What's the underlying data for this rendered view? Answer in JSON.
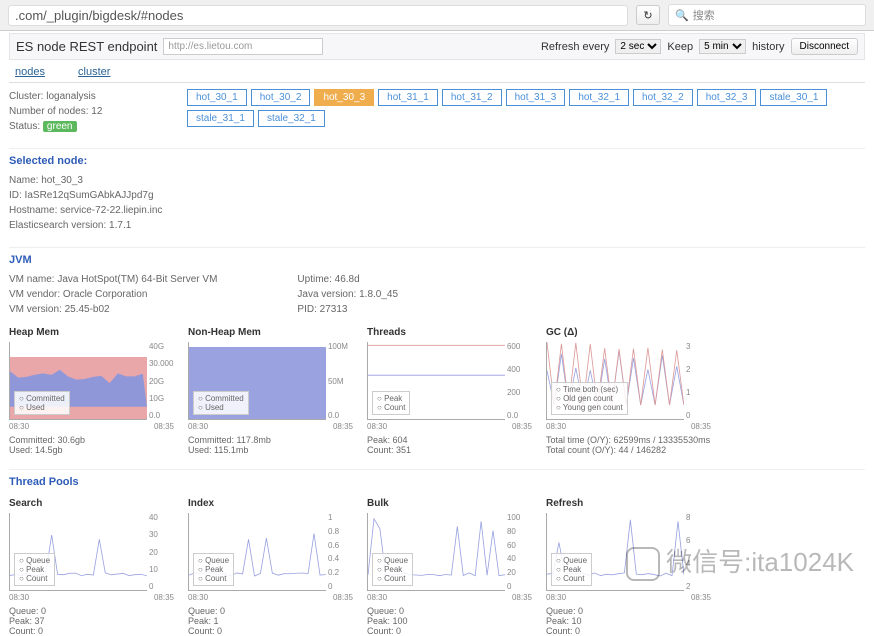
{
  "browser": {
    "url": ".com/_plugin/bigdesk/#nodes",
    "search_placeholder": "搜索"
  },
  "header": {
    "endpoint_label": "ES node REST endpoint",
    "endpoint_value": "http://es.lietou.com",
    "refresh_label": "Refresh every",
    "refresh_options": [
      "2 sec"
    ],
    "refresh_selected": "2 sec",
    "keep_label": "Keep",
    "keep_options": [
      "5 min"
    ],
    "keep_selected": "5 min",
    "history_label": "history",
    "disconnect_label": "Disconnect",
    "tabs": {
      "nodes": "nodes",
      "cluster": "cluster"
    }
  },
  "cluster": {
    "name_label": "Cluster: loganalysis",
    "nodes_label": "Number of nodes: 12",
    "status_label": "Status:",
    "status_value": "green"
  },
  "nodes": [
    "hot_30_1",
    "hot_30_2",
    "hot_30_3",
    "hot_31_1",
    "hot_31_2",
    "hot_31_3",
    "hot_32_1",
    "hot_32_2",
    "hot_32_3",
    "stale_30_1",
    "stale_31_1",
    "stale_32_1"
  ],
  "selected_node_index": 2,
  "selected_node": {
    "title": "Selected node:",
    "name": "Name: hot_30_3",
    "id": "ID: IaSRe12qSumGAbkAJJpd7g",
    "hostname": "Hostname: service-72-22.liepin.inc",
    "version": "Elasticsearch version: 1.7.1"
  },
  "jvm": {
    "title": "JVM",
    "left": {
      "vm_name": "VM name: Java HotSpot(TM) 64-Bit Server VM",
      "vm_vendor": "VM vendor: Oracle Corporation",
      "vm_version": "VM version: 25.45-b02"
    },
    "right": {
      "uptime": "Uptime: 46.8d",
      "java_version": "Java version: 1.8.0_45",
      "pid": "PID: 27313"
    }
  },
  "chart_data": [
    {
      "type": "area",
      "title": "Heap Mem",
      "x": [
        "08:30",
        "08:35"
      ],
      "y_ticks": [
        "40G",
        "30.000",
        "20G",
        "10G",
        "0.0"
      ],
      "series": [
        {
          "name": "Committed",
          "values": [
            30.6,
            30.6
          ]
        },
        {
          "name": "Used",
          "values": [
            14,
            15,
            18,
            14,
            16,
            19,
            14,
            17,
            15,
            16,
            14,
            18,
            15,
            14
          ]
        }
      ],
      "stats": {
        "committed": "Committed: 30.6gb",
        "used": "Used: 14.5gb"
      }
    },
    {
      "type": "area",
      "title": "Non-Heap Mem",
      "x": [
        "08:30",
        "08:35"
      ],
      "y_ticks": [
        "100M",
        "50M",
        "0.0"
      ],
      "series": [
        {
          "name": "Committed",
          "values": [
            117.8,
            117.8
          ]
        },
        {
          "name": "Used",
          "values": [
            115.1,
            115.1
          ]
        }
      ],
      "stats": {
        "committed": "Committed: 117.8mb",
        "used": "Used: 115.1mb"
      }
    },
    {
      "type": "line",
      "title": "Threads",
      "x": [
        "08:30",
        "08:35"
      ],
      "y_ticks": [
        "600",
        "400",
        "200",
        "0.0"
      ],
      "series": [
        {
          "name": "Peak",
          "values": [
            604,
            604
          ]
        },
        {
          "name": "Count",
          "values": [
            351,
            351
          ]
        }
      ],
      "stats": {
        "peak": "Peak: 604",
        "count": "Count: 351"
      }
    },
    {
      "type": "line",
      "title": "GC (Δ)",
      "x": [
        "08:30",
        "08:35"
      ],
      "y_ticks": [
        "3",
        "2",
        "1",
        "0"
      ],
      "series": [
        {
          "name": "Time both (sec)",
          "values": [
            3,
            0,
            1,
            0,
            2,
            0,
            1,
            0,
            2,
            0,
            1,
            0,
            1.5,
            0,
            1,
            0
          ]
        },
        {
          "name": "Old gen count",
          "values": [
            0,
            0,
            0,
            0
          ]
        },
        {
          "name": "Young gen count",
          "values": [
            0,
            2,
            0,
            1,
            0,
            2,
            0,
            1,
            0,
            2,
            0,
            1,
            0,
            2,
            0
          ]
        }
      ],
      "stats": {
        "time": "Total time (O/Y): 62599ms / 13335530ms",
        "count": "Total count (O/Y): 44 / 146282"
      }
    }
  ],
  "thread_pools": {
    "title": "Thread Pools",
    "charts": [
      {
        "type": "line",
        "title": "Search",
        "x": [
          "08:30",
          "08:35"
        ],
        "y_ticks": [
          "40",
          "30",
          "20",
          "10",
          "0"
        ],
        "series": [
          {
            "name": "Queue"
          },
          {
            "name": "Peak"
          },
          {
            "name": "Count"
          }
        ],
        "stats": {
          "queue": "Queue: 0",
          "peak": "Peak: 37",
          "count": "Count: 0"
        }
      },
      {
        "type": "line",
        "title": "Index",
        "x": [
          "08:30",
          "08:35"
        ],
        "y_ticks": [
          "1",
          "0.8",
          "0.6",
          "0.4",
          "0.2",
          "0"
        ],
        "series": [
          {
            "name": "Queue"
          },
          {
            "name": "Peak"
          },
          {
            "name": "Count"
          }
        ],
        "stats": {
          "queue": "Queue: 0",
          "peak": "Peak: 1",
          "count": "Count: 0"
        }
      },
      {
        "type": "line",
        "title": "Bulk",
        "x": [
          "08:30",
          "08:35"
        ],
        "y_ticks": [
          "100",
          "80",
          "60",
          "40",
          "20",
          "0"
        ],
        "series": [
          {
            "name": "Queue"
          },
          {
            "name": "Peak"
          },
          {
            "name": "Count"
          }
        ],
        "stats": {
          "queue": "Queue: 0",
          "peak": "Peak: 100",
          "count": "Count: 0"
        }
      },
      {
        "type": "line",
        "title": "Refresh",
        "x": [
          "08:30",
          "08:35"
        ],
        "y_ticks": [
          "8",
          "6",
          "4",
          "2"
        ],
        "series": [
          {
            "name": "Queue"
          },
          {
            "name": "Peak"
          },
          {
            "name": "Count"
          }
        ],
        "stats": {
          "queue": "Queue: 0",
          "peak": "Peak: 10",
          "count": "Count: 0"
        }
      }
    ]
  },
  "watermark": "微信号:ita1024K"
}
